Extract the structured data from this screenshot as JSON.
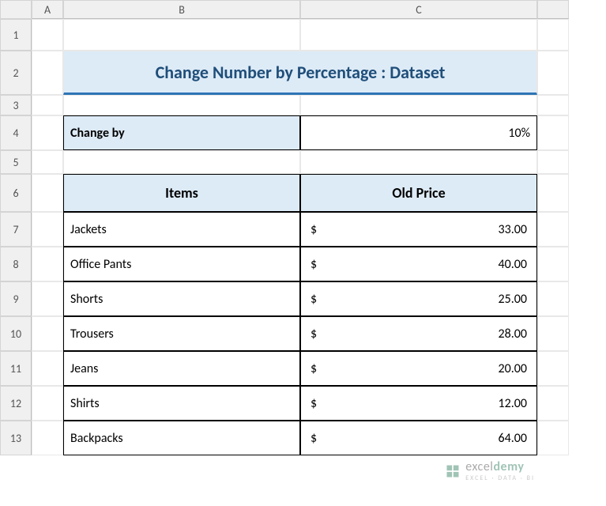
{
  "columns": [
    "A",
    "B",
    "C"
  ],
  "rows": [
    "1",
    "2",
    "3",
    "4",
    "5",
    "6",
    "7",
    "8",
    "9",
    "10",
    "11",
    "12",
    "13"
  ],
  "title": "Change Number by Percentage : Dataset",
  "change": {
    "label": "Change by",
    "value": "10%"
  },
  "table": {
    "headers": {
      "items": "Items",
      "price": "Old Price"
    },
    "currency": "$",
    "rows": [
      {
        "item": "Jackets",
        "price": "33.00"
      },
      {
        "item": "Office Pants",
        "price": "40.00"
      },
      {
        "item": "Shorts",
        "price": "25.00"
      },
      {
        "item": "Trousers",
        "price": "28.00"
      },
      {
        "item": "Jeans",
        "price": "20.00"
      },
      {
        "item": "Shirts",
        "price": "12.00"
      },
      {
        "item": "Backpacks",
        "price": "64.00"
      }
    ]
  },
  "watermark": {
    "brand_part1": "excel",
    "brand_part2": "demy",
    "tagline": "EXCEL · DATA · BI"
  }
}
